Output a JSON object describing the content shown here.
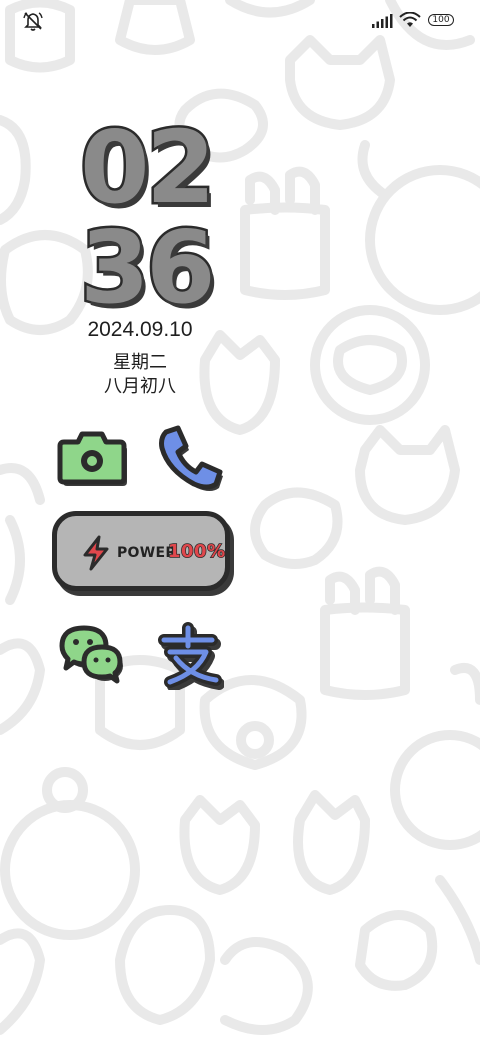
{
  "status_bar": {
    "battery_level": "100",
    "icons": [
      "mute-icon",
      "signal-icon",
      "wifi-icon",
      "battery-icon"
    ]
  },
  "clock": {
    "hour_tens": "0",
    "hour_ones": "2",
    "minute_tens": "3",
    "minute_ones": "6"
  },
  "date": {
    "date": "2024.09.10",
    "weekday": "星期二",
    "lunar": "八月初八"
  },
  "apps": [
    {
      "name": "camera",
      "icon": "camera-icon",
      "color": "#8fd68a"
    },
    {
      "name": "phone",
      "icon": "phone-icon",
      "color": "#6e8fe6"
    },
    {
      "name": "wechat",
      "icon": "wechat-icon",
      "color": "#8fd68a"
    },
    {
      "name": "alipay",
      "icon": "alipay-icon",
      "color": "#6e8fe6"
    }
  ],
  "power_widget": {
    "label": "POWER",
    "value": "100%",
    "level": 1.0,
    "accent": "#e0474c",
    "icon": "lightning-bolt-icon"
  },
  "colors": {
    "widget_gray": "#b5b5b5",
    "outline": "#2b2b2b",
    "background_pattern": "#e8e8e8"
  }
}
